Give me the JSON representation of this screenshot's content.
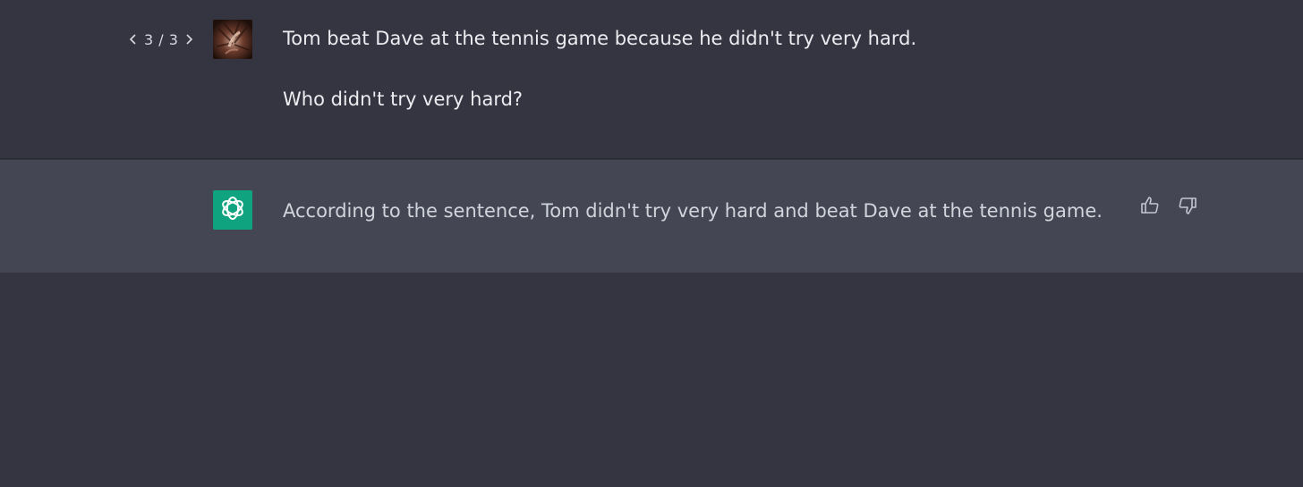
{
  "conversation": {
    "user": {
      "pager": {
        "current": "3 / 3"
      },
      "lines": [
        "Tom beat Dave at the tennis game because he didn't try very hard.",
        "Who didn't try very hard?"
      ]
    },
    "assistant": {
      "text": "According to the sentence, Tom didn't try very hard and beat Dave at the tennis game."
    }
  },
  "icons": {
    "prev": "chevron-left-icon",
    "next": "chevron-right-icon",
    "like": "thumbs-up-icon",
    "dislike": "thumbs-down-icon",
    "assistant_logo": "openai-logo-icon"
  },
  "colors": {
    "background": "#343541",
    "assistant_background": "#444654",
    "assistant_avatar": "#10a37f"
  }
}
